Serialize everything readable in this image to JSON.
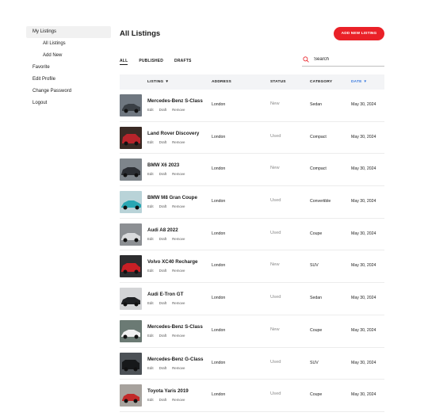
{
  "sidebar": {
    "items": [
      {
        "label": "My Listings"
      },
      {
        "label": "All Listings"
      },
      {
        "label": "Add New"
      },
      {
        "label": "Favorite"
      },
      {
        "label": "Edit Profile"
      },
      {
        "label": "Change Password"
      },
      {
        "label": "Logout"
      }
    ]
  },
  "header": {
    "title": "All Listings",
    "add_button": "ADD NEW LISTING"
  },
  "tabs": [
    {
      "label": "ALL"
    },
    {
      "label": "PUBLISHED"
    },
    {
      "label": "DRAFTS"
    }
  ],
  "search": {
    "placeholder": "Search"
  },
  "table": {
    "headers": {
      "listing": "LISTING",
      "address": "ADDRESS",
      "status": "STATUS",
      "category": "CATEGORY",
      "date": "DATE"
    },
    "actions": {
      "edit": "Edit",
      "draft": "Draft",
      "remove": "Remove"
    },
    "rows": [
      {
        "name": "Mercedes-Benz S-Class",
        "address": "London",
        "status": "New",
        "category": "Sedan",
        "date": "May 30, 2024"
      },
      {
        "name": "Land Rover Discovery",
        "address": "London",
        "status": "Used",
        "category": "Compact",
        "date": "May 30, 2024"
      },
      {
        "name": "BMW X6 2023",
        "address": "London",
        "status": "New",
        "category": "Compact",
        "date": "May 30, 2024"
      },
      {
        "name": "BMW M8 Gran Coupe",
        "address": "London",
        "status": "Used",
        "category": "Convertible",
        "date": "May 30, 2024"
      },
      {
        "name": "Audi A8 2022",
        "address": "London",
        "status": "Used",
        "category": "Coupe",
        "date": "May 30, 2024"
      },
      {
        "name": "Volvo XC40 Recharge",
        "address": "London",
        "status": "New",
        "category": "SUV",
        "date": "May 30, 2024"
      },
      {
        "name": "Audi E-Tron GT",
        "address": "London",
        "status": "Used",
        "category": "Sedan",
        "date": "May 30, 2024"
      },
      {
        "name": "Mercedes-Benz S-Class",
        "address": "London",
        "status": "New",
        "category": "Coupe",
        "date": "May 30, 2024"
      },
      {
        "name": "Mercedes-Benz G-Class",
        "address": "London",
        "status": "Used",
        "category": "SUV",
        "date": "May 30, 2024"
      },
      {
        "name": "Toyota Yaris 2019",
        "address": "London",
        "status": "Used",
        "category": "Coupe",
        "date": "May 30, 2024"
      }
    ]
  },
  "colors": {
    "accent": "#ea2128",
    "date_header": "#3a7be0",
    "header_bg": "#f3f4f6"
  },
  "thumbs": [
    {
      "bg": "#6f7780",
      "car": "#3a3f45"
    },
    {
      "bg": "#3a2a24",
      "car": "#b8242b"
    },
    {
      "bg": "#7e858b",
      "car": "#2b2e33"
    },
    {
      "bg": "#b9d3d8",
      "car": "#2aa7b3"
    },
    {
      "bg": "#8c8f93",
      "car": "#d9dadc"
    },
    {
      "bg": "#2d2d2f",
      "car": "#c81f25"
    },
    {
      "bg": "#d3d4d6",
      "car": "#1f2124"
    },
    {
      "bg": "#6b7a74",
      "car": "#f0f0f0"
    },
    {
      "bg": "#4c5156",
      "car": "#16181a"
    },
    {
      "bg": "#a7a29d",
      "car": "#c22a2a"
    }
  ]
}
